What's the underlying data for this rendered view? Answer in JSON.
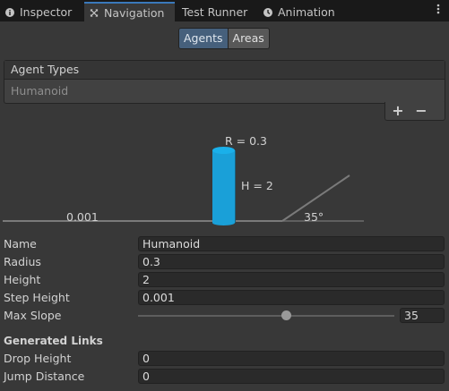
{
  "tabs": [
    {
      "label": "Inspector",
      "icon": "info-icon"
    },
    {
      "label": "Navigation",
      "icon": "navigation-icon"
    },
    {
      "label": "Test Runner",
      "icon": ""
    },
    {
      "label": "Animation",
      "icon": "clock-icon"
    }
  ],
  "active_tab": "Navigation",
  "mode_tabs": [
    "Agents",
    "Areas"
  ],
  "active_mode": "Agents",
  "agent_types": {
    "header": "Agent Types",
    "items": [
      "Humanoid"
    ],
    "add_label": "+",
    "remove_label": "−"
  },
  "visualization": {
    "radius_label": "R = 0.3",
    "height_label": "H = 2",
    "step_label": "0.001",
    "slope_label": "35°",
    "agent_color": "#1aa0d8"
  },
  "fields": {
    "name": {
      "label": "Name",
      "value": "Humanoid"
    },
    "radius": {
      "label": "Radius",
      "value": "0.3"
    },
    "height": {
      "label": "Height",
      "value": "2"
    },
    "step_height": {
      "label": "Step Height",
      "value": "0.001"
    },
    "max_slope": {
      "label": "Max Slope",
      "value": "35",
      "slider_fraction": 0.58
    }
  },
  "generated_links": {
    "title": "Generated Links",
    "drop_height": {
      "label": "Drop Height",
      "value": "0"
    },
    "jump_distance": {
      "label": "Jump Distance",
      "value": "0"
    }
  }
}
